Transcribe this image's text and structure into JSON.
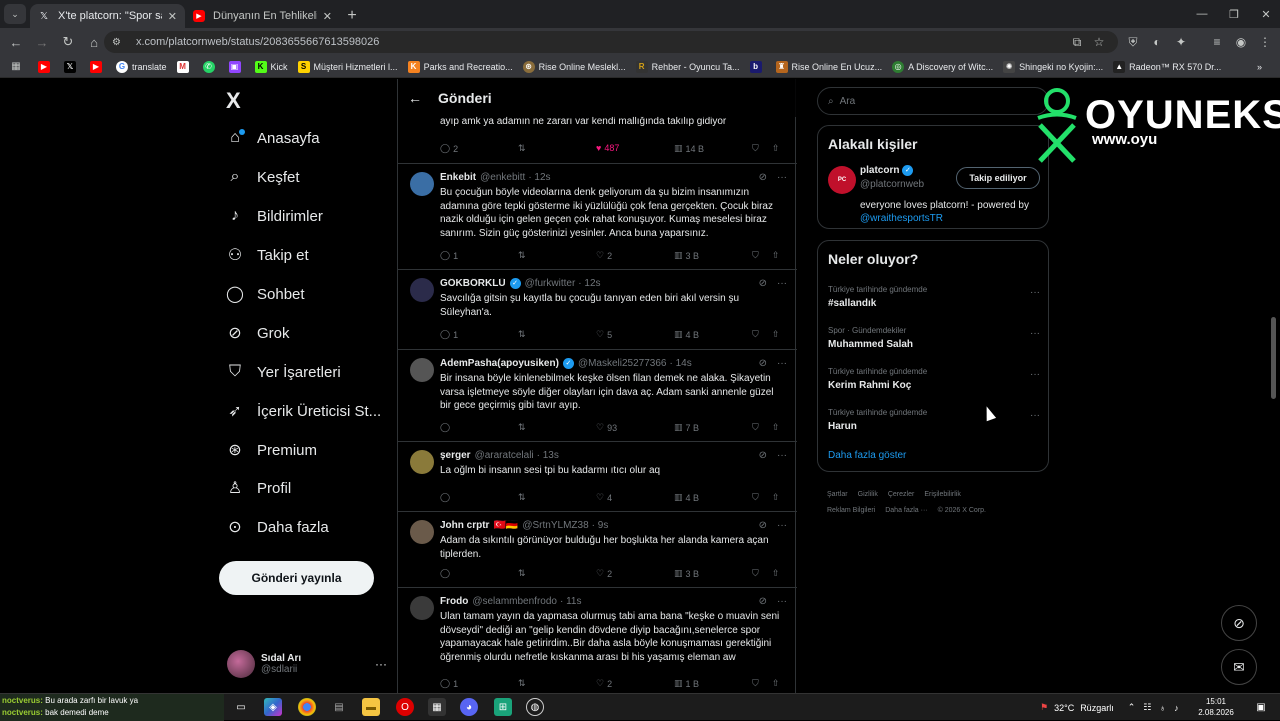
{
  "browser": {
    "tabs": [
      {
        "title": "X'te platcorn: \"Spor salonunda",
        "active": true
      },
      {
        "title": "Dünyanın En Tehlikeli Deniz Can",
        "active": false
      }
    ],
    "url": "x.com/platcornweb/status/2083655667613598026",
    "bookmarks": [
      "translate",
      "Kick",
      "Müşteri Hizmetleri l...",
      "Parks and Recreatio...",
      "Rise Online Meslekl...",
      "Rehber - Oyuncu Ta...",
      "Rise Online En Ucuz...",
      "A Discovery of Witc...",
      "Shingeki no Kyojin:...",
      "Radeon™ RX 570 Dr..."
    ]
  },
  "nav": {
    "logo": "X",
    "items": [
      {
        "label": "Anasayfa",
        "icon": "home-icon",
        "glyph": "⌂"
      },
      {
        "label": "Keşfet",
        "icon": "search-icon",
        "glyph": "⌕"
      },
      {
        "label": "Bildirimler",
        "icon": "bell-icon",
        "glyph": "♪"
      },
      {
        "label": "Takip et",
        "icon": "add-user-icon",
        "glyph": "⚇"
      },
      {
        "label": "Sohbet",
        "icon": "chat-icon",
        "glyph": "◯"
      },
      {
        "label": "Grok",
        "icon": "grok-icon",
        "glyph": "⊘"
      },
      {
        "label": "Yer İşaretleri",
        "icon": "bookmark-icon",
        "glyph": "⛉"
      },
      {
        "label": "İçerik Üreticisi St...",
        "icon": "rocket-icon",
        "glyph": "➶"
      },
      {
        "label": "Premium",
        "icon": "premium-icon",
        "glyph": "⊛"
      },
      {
        "label": "Profil",
        "icon": "profile-icon",
        "glyph": "♙"
      },
      {
        "label": "Daha fazla",
        "icon": "more-icon",
        "glyph": "⊙"
      }
    ],
    "post_button": "Gönderi yayınla",
    "account": {
      "name": "Sıdal Arı",
      "handle": "@sdlarii"
    }
  },
  "header": {
    "title": "Gönderi"
  },
  "tweets": [
    {
      "name": "",
      "handle": "",
      "time": "",
      "text": "ayıp amk ya adamın ne zararı var kendi mallığında takılıp gidiyor",
      "replies": "2",
      "reposts": "",
      "likes": "487",
      "views": "14 B",
      "liked": true
    },
    {
      "name": "Enkebit",
      "handle": "@enkebitt",
      "time": "· 12s",
      "text": "Bu çocuğun böyle videolarına denk geliyorum da şu bizim insanımızın adamına göre tepki gösterme iki yüzlülüğü çok fena gerçekten. Çocuk biraz nazik olduğu için gelen geçen çok rahat konuşuyor. Kumaş meselesi biraz sanırım. Sizin güç gösterinizi yesinler. Anca buna yaparsınız.",
      "replies": "1",
      "reposts": "",
      "likes": "2",
      "views": "3 B",
      "liked": false
    },
    {
      "name": "GÖKBÖRKLÜ",
      "handle": "@furkwitter",
      "time": "· 12s",
      "text": "Savcılığa gitsin şu kayıtla bu çocuğu tanıyan eden biri akıl versin şu Süleyhan'a.",
      "replies": "1",
      "reposts": "",
      "likes": "5",
      "views": "4 B",
      "liked": false,
      "verified": true
    },
    {
      "name": "AdemPasha(apoyusiken)",
      "handle": "@Maskeli25277366",
      "time": "· 14s",
      "text": "Bir insana böyle kinlenebilmek keşke ölsen filan demek ne alaka. Şikayetin varsa işletmeye söyle diğer olayları için dava aç. Adam sanki annenle güzel bir gece geçirmiş gibi tavır ayıp.",
      "replies": "",
      "reposts": "",
      "likes": "93",
      "views": "7 B",
      "liked": false,
      "verified": true
    },
    {
      "name": "şerger",
      "handle": "@araratcelali",
      "time": "· 13s",
      "text": "La oğlm bi insanın sesi tpi bu kadarmı ıtıcı olur aq",
      "replies": "",
      "reposts": "",
      "likes": "4",
      "views": "4 B",
      "liked": false
    },
    {
      "name": "John crptr",
      "handle": "@SrtnYLMZ38",
      "time": "· 9s",
      "text": "Adam da sıkıntılı görünüyor bulduğu her boşlukta her alanda kamera açan tiplerden.",
      "replies": "",
      "reposts": "",
      "likes": "2",
      "views": "3 B",
      "liked": false,
      "flags": "🇹🇷🇩🇪"
    },
    {
      "name": "Frodo",
      "handle": "@selammbenfrodo",
      "time": "· 11s",
      "text": "Ulan tamam yayın da yapmasa olurmuş tabi ama bana \"keşke o muavin seni dövseydi\" dediği an \"gelip kendin dövdene diyip bacağını,senelerce spor yapamayacak hale getirirdim..Bir daha asla böyle konuşmaması gerektiğini öğrenmiş olurdu nefretle kıskanma arası bi his yaşamış eleman aw",
      "replies": "1",
      "reposts": "",
      "likes": "2",
      "views": "1 B",
      "liked": false
    }
  ],
  "right": {
    "search_placeholder": "Ara",
    "related_title": "Alakalı kişiler",
    "related": {
      "name": "platcorn",
      "handle": "@platcornweb",
      "follow_label": "Takip ediliyor",
      "bio": "everyone loves platcorn! - powered by",
      "bio_link": "@wraithesportsTR"
    },
    "trends_title": "Neler oluyor?",
    "trends": [
      {
        "category": "Türkiye tarihinde gündemde",
        "name": "#sallandık"
      },
      {
        "category": "Spor · Gündemdekiler",
        "name": "Muhammed Salah"
      },
      {
        "category": "Türkiye tarihinde gündemde",
        "name": "Kerim Rahmi Koç"
      },
      {
        "category": "Türkiye tarihinde gündemde",
        "name": "Harun"
      }
    ],
    "show_more": "Daha fazla göster",
    "footer": [
      "Şartlar",
      "Gizlilik",
      "Çerezler",
      "Erişilebilirlik",
      "Reklam Bilgileri",
      "Daha fazla ···",
      "© 2026 X Corp."
    ]
  },
  "watermark": {
    "brand": "OYUNEKS",
    "url": "www.oyu"
  },
  "taskbar": {
    "chat": [
      {
        "user": "noctverus:",
        "msg": "Bu arada zarfı bir lavuk ya"
      },
      {
        "user": "noctverus:",
        "msg": "bak demedi deme"
      }
    ],
    "weather": "32°C",
    "wind": "Rüzgarlı",
    "time": "15:01",
    "date": "2.08.2026"
  }
}
